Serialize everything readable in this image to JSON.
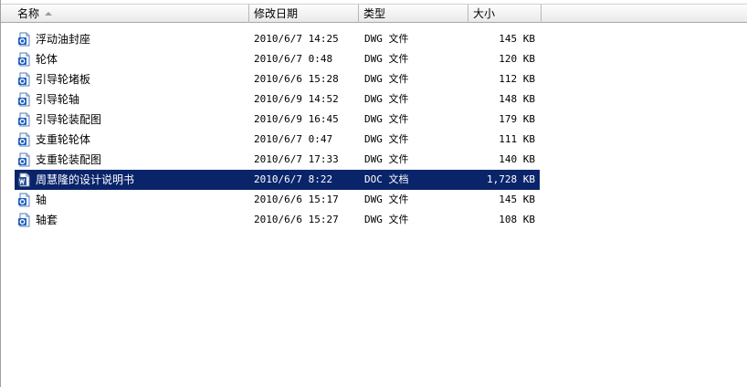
{
  "columns": {
    "name": "名称",
    "date": "修改日期",
    "type": "类型",
    "size": "大小"
  },
  "files": [
    {
      "name": "浮动油封座",
      "date": "2010/6/7 14:25",
      "type": "DWG 文件",
      "size": "145 KB",
      "icon": "dwg-file-icon",
      "selected": false
    },
    {
      "name": "轮体",
      "date": "2010/6/7 0:48",
      "type": "DWG 文件",
      "size": "120 KB",
      "icon": "dwg-file-icon",
      "selected": false
    },
    {
      "name": "引导轮堵板",
      "date": "2010/6/6 15:28",
      "type": "DWG 文件",
      "size": "112 KB",
      "icon": "dwg-file-icon",
      "selected": false
    },
    {
      "name": "引导轮轴",
      "date": "2010/6/9 14:52",
      "type": "DWG 文件",
      "size": "148 KB",
      "icon": "dwg-file-icon",
      "selected": false
    },
    {
      "name": "引导轮装配图",
      "date": "2010/6/9 16:45",
      "type": "DWG 文件",
      "size": "179 KB",
      "icon": "dwg-file-icon",
      "selected": false
    },
    {
      "name": "支重轮轮体",
      "date": "2010/6/7 0:47",
      "type": "DWG 文件",
      "size": "111 KB",
      "icon": "dwg-file-icon",
      "selected": false
    },
    {
      "name": "支重轮装配图",
      "date": "2010/6/7 17:33",
      "type": "DWG 文件",
      "size": "140 KB",
      "icon": "dwg-file-icon",
      "selected": false
    },
    {
      "name": "周慧隆的设计说明书",
      "date": "2010/6/7 8:22",
      "type": "DOC 文档",
      "size": "1,728 KB",
      "icon": "doc-file-icon",
      "selected": true
    },
    {
      "name": "轴",
      "date": "2010/6/6 15:17",
      "type": "DWG 文件",
      "size": "145 KB",
      "icon": "dwg-file-icon",
      "selected": false
    },
    {
      "name": "轴套",
      "date": "2010/6/6 15:27",
      "type": "DWG 文件",
      "size": "108 KB",
      "icon": "dwg-file-icon",
      "selected": false
    }
  ],
  "colors": {
    "selection": "#0a246a",
    "dwg_icon": "#1f5fbf",
    "doc_icon": "#2b579a"
  }
}
